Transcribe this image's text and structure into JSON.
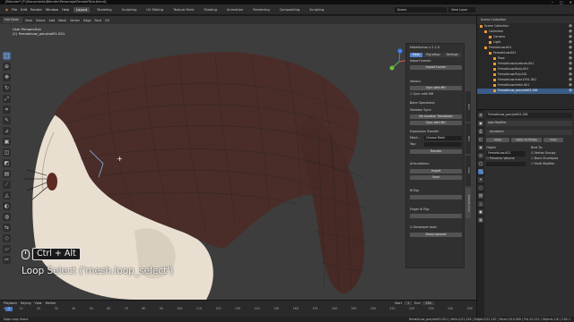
{
  "window": {
    "title": "[Blender* [F:\\Documents\\Blender\\Personaje\\FemaleTuto.blend]",
    "controls": [
      "–",
      "▢",
      "✕"
    ]
  },
  "menus": [
    "File",
    "Edit",
    "Render",
    "Window",
    "Help"
  ],
  "workspaces": [
    {
      "label": "Layout",
      "active": true
    },
    {
      "label": "Modeling",
      "active": false
    },
    {
      "label": "Sculpting",
      "active": false
    },
    {
      "label": "UV Editing",
      "active": false
    },
    {
      "label": "Texture Paint",
      "active": false
    },
    {
      "label": "Shading",
      "active": false
    },
    {
      "label": "Animation",
      "active": false
    },
    {
      "label": "Rendering",
      "active": false
    },
    {
      "label": "Compositing",
      "active": false
    },
    {
      "label": "Scripting",
      "active": false
    }
  ],
  "scene_name": "Scene",
  "view_layer": "View Layer",
  "viewport": {
    "mode": "Edit Mode",
    "header_menus": [
      "View",
      "Select",
      "Add",
      "Mesh",
      "Vertex",
      "Edge",
      "Face",
      "UV"
    ],
    "info_line1": "User Perspective",
    "info_line2": "(1) FemaleLow_ponytail01.001",
    "hint_combo": "Ctrl + Alt",
    "hint_text": "Loop Select ('mesh.loop_select')"
  },
  "npanel": {
    "title": "MakeHuman v 1.1.0",
    "tabs": [
      {
        "label": "Mesh",
        "on": true
      },
      {
        "label": "Rig setup",
        "on": false
      },
      {
        "label": "Settings",
        "on": false
      }
    ],
    "import_label": "Import human",
    "import_button": "Import human",
    "various_label": "Various",
    "sync_mh_button": "Sync with MH",
    "sync_mh_checkbox": "Sync with MH",
    "bone_ops_label": "Bone Operations",
    "skeleton_sync_label": "Skeleton Sync:",
    "no_location_button": "No Location Translation",
    "sync_with_mh_button": "Sync with MH",
    "expression_label": "Expression Transfer",
    "expr_field_label": "Mesh...",
    "expr_field_value": "Choose Mesh",
    "tag_label": "Tag:",
    "transfer_button": "Transfer",
    "articulations_label": "Articulations:",
    "import_button2": "Import",
    "save_button": "Save",
    "irig_label": "IK Rig:",
    "finger_label": "Finger IK Rig:",
    "developer_tools_label": "Developer tools",
    "dump_button": "Dump ignored"
  },
  "side_tabs": [
    "Item",
    "Tool",
    "View",
    "MakeHuman"
  ],
  "timeline": {
    "controls": [
      "Playback",
      "Keying",
      "View",
      "Marker"
    ],
    "current_frame": "1",
    "ticks": [
      "0",
      "10",
      "20",
      "30",
      "40",
      "50",
      "60",
      "70",
      "80",
      "90",
      "100",
      "110",
      "120",
      "130",
      "140",
      "150",
      "160",
      "170",
      "180",
      "190",
      "200",
      "210",
      "220",
      "230",
      "240",
      "250"
    ],
    "start_label": "Start",
    "start_value": "1",
    "end_label": "End",
    "end_value": "250"
  },
  "status": {
    "left": "Edge Loop Select",
    "right": "FemaleLow_ponytail01.001 | Verts 0/11,226 | Edges 0/21,187 | Faces 0/10,069 | Tris 20,122 | Objects 1/6 | 2.82.1"
  },
  "outliner": {
    "header": "Scene Collection",
    "rows": [
      {
        "label": "Scene Collection",
        "indent": 0,
        "sel": false
      },
      {
        "label": "Collection",
        "indent": 1,
        "sel": false
      },
      {
        "label": "Camera",
        "indent": 2,
        "sel": false
      },
      {
        "label": "Light",
        "indent": 2,
        "sel": false
      },
      {
        "label": "FemaleLow.001",
        "indent": 1,
        "sel": false
      },
      {
        "label": "FemaleLow.001",
        "indent": 2,
        "sel": false
      },
      {
        "label": "Pose",
        "indent": 3,
        "sel": false
      },
      {
        "label": "FemaleLow.eyebrow.001",
        "indent": 3,
        "sel": false
      },
      {
        "label": "FemaleLow.Body.001",
        "indent": 3,
        "sel": false
      },
      {
        "label": "FemaleLow.Poly.001",
        "indent": 3,
        "sel": false
      },
      {
        "label": "FemaleLow.male1591.001",
        "indent": 3,
        "sel": false
      },
      {
        "label": "FemaleLow.teeth.001",
        "indent": 3,
        "sel": false
      },
      {
        "label": "FemaleLow_ponytail01.001",
        "indent": 3,
        "sel": true
      }
    ]
  },
  "properties": {
    "object_name": "FemaleLow_ponytail01.001",
    "add_modifier": "Add Modifier",
    "modifier_name": "Armature",
    "apply_button": "Apply",
    "copy_button": "Copy",
    "apply_shape": "Apply as Shape",
    "object_label": "Object",
    "object_value": "FemaleLow.001",
    "bind_to_label": "Bind To:",
    "vertex_groups": "Vertex Groups",
    "preserve_volume": "Preserve Volume",
    "bone_envelopes": "Bone Envelopes",
    "multi_modifier": "Multi Modifier"
  }
}
